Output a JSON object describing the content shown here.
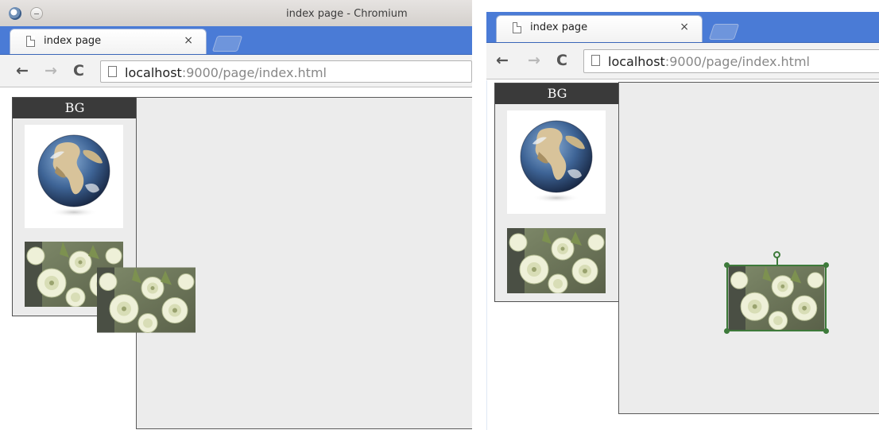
{
  "left_window": {
    "window_title": "index page - Chromium",
    "tab": {
      "title": "index page",
      "close": "×"
    },
    "toolbar": {
      "back": "←",
      "forward": "→",
      "reload": "C"
    },
    "address": {
      "host": "localhost",
      "path": ":9000/page/index.html"
    },
    "panel": {
      "header": "BG",
      "thumbnails": [
        "globe-image",
        "flowers-image"
      ]
    },
    "canvas": {
      "background": "#ececec",
      "dragged_item": "flowers-image"
    }
  },
  "right_window": {
    "tab": {
      "title": "index page",
      "close": "×"
    },
    "toolbar": {
      "back": "←",
      "forward": "→",
      "reload": "C"
    },
    "address": {
      "host": "localhost",
      "path": ":9000/page/index.html"
    },
    "panel": {
      "header": "BG",
      "thumbnails": [
        "globe-image",
        "flowers-image"
      ]
    },
    "canvas": {
      "background": "#ececec",
      "selected_item": "flowers-image",
      "selection_color": "#3d7a3a"
    }
  },
  "colors": {
    "tabstrip": "#4a7bd6",
    "panel_header": "#3a3a3a",
    "canvas": "#ececec",
    "selection": "#3d7a3a"
  }
}
